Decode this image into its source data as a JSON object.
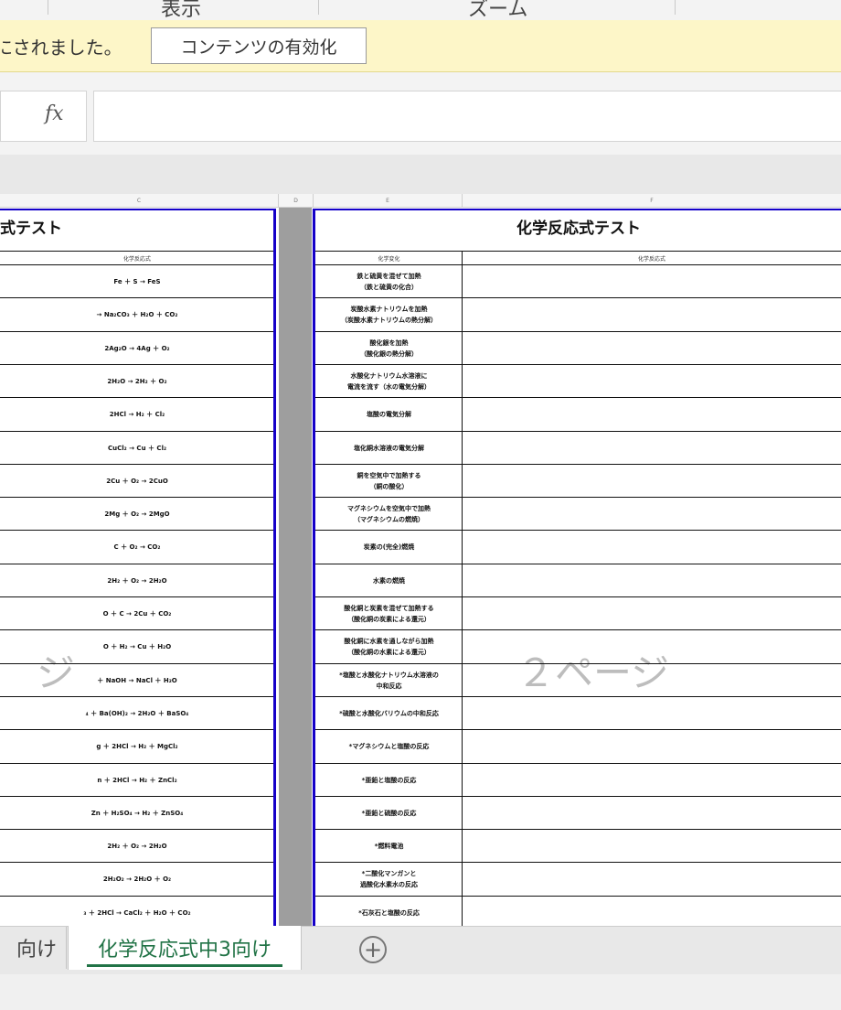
{
  "ribbon": {
    "group_display": "表示",
    "group_zoom": "ズーム"
  },
  "message_bar": {
    "text": "にされました。",
    "enable_button": "コンテンツの有効化"
  },
  "formula_bar": {
    "fx_label": "fx",
    "value": ""
  },
  "columns": {
    "c": "C",
    "d": "D",
    "e": "E",
    "f": "F"
  },
  "page_left": {
    "title": "式テスト",
    "subhead": "化学反応式",
    "watermark": "ジ",
    "equations": [
      "Fe ＋ S → FeS",
      "→ Na₂CO₃ ＋ H₂O ＋ CO₂",
      "2Ag₂O → 4Ag ＋ O₂",
      "2H₂O → 2H₂ ＋ O₂",
      "2HCl → H₂ ＋ Cl₂",
      "CuCl₂ → Cu ＋ Cl₂",
      "2Cu ＋ O₂ → 2CuO",
      "2Mg ＋ O₂ → 2MgO",
      "C ＋ O₂ → CO₂",
      "2H₂ ＋ O₂ → 2H₂O",
      "O ＋ C → 2Cu ＋ CO₂",
      "O ＋ H₂ → Cu ＋ H₂O",
      "＋ NaOH → NaCl ＋ H₂O",
      "₄ ＋ Ba(OH)₂ → 2H₂O ＋ BaSO₄",
      "g ＋ 2HCl → H₂ ＋ MgCl₂",
      "n ＋ 2HCl → H₂ ＋ ZnCl₂",
      "Zn ＋ H₂SO₄ → H₂ ＋ ZnSO₄",
      "2H₂ ＋ O₂ → 2H₂O",
      "2H₂O₂ → 2H₂O ＋ O₂",
      "₃ ＋ 2HCl → CaCl₂ ＋ H₂O ＋ CO₂"
    ]
  },
  "page_right": {
    "title": "化学反応式テスト",
    "col1_header": "化学変化",
    "col2_header": "化学反応式",
    "watermark": "２ページ",
    "changes": [
      "鉄と硫黄を混ぜて加熱\n（鉄と硫黄の化合）",
      "炭酸水素ナトリウムを加熱\n（炭酸水素ナトリウムの熱分解）",
      "酸化銀を加熱\n（酸化銀の熱分解）",
      "水酸化ナトリウム水溶液に\n電流を流す（水の電気分解）",
      "塩酸の電気分解",
      "塩化銅水溶液の電気分解",
      "銅を空気中で加熱する\n（銅の酸化）",
      "マグネシウムを空気中で加熱\n（マグネシウムの燃焼）",
      "炭素の(完全)燃焼",
      "水素の燃焼",
      "酸化銅と炭素を混ぜて加熱する\n（酸化銅の炭素による還元）",
      "酸化銅に水素を通しながら加熱\n（酸化銅の水素による還元）",
      "*塩酸と水酸化ナトリウム水溶液の\n中和反応",
      "*硫酸と水酸化バリウムの中和反応",
      "*マグネシウムと塩酸の反応",
      "*亜鉛と塩酸の反応",
      "*亜鉛と硫酸の反応",
      "*燃料電池",
      "*二酸化マンガンと\n過酸化水素水の反応",
      "*石灰石と塩酸の反応"
    ]
  },
  "tabs": {
    "previous": "向け",
    "active": "化学反応式中3向け",
    "add_label": "+"
  }
}
